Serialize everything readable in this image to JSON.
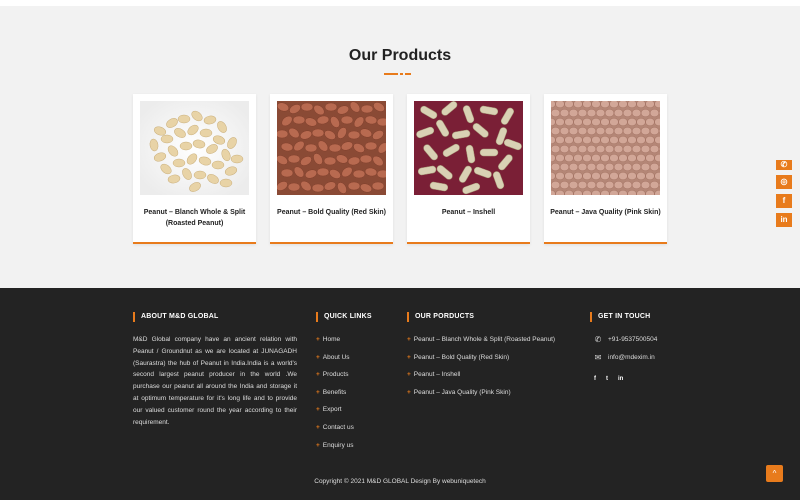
{
  "products_section": {
    "title": "Our Products",
    "items": [
      {
        "name": "Peanut – Blanch Whole & Split (Roasted Peanut)",
        "image": "blanched-peanuts-image"
      },
      {
        "name": "Peanut – Bold Quality (Red Skin)",
        "image": "red-skin-peanuts-image"
      },
      {
        "name": "Peanut – Inshell",
        "image": "inshell-peanuts-image"
      },
      {
        "name": "Peanut – Java Quality (Pink Skin)",
        "image": "pink-skin-peanuts-image"
      }
    ]
  },
  "floating_social": [
    {
      "icon": "phone-icon",
      "glyph": "✆"
    },
    {
      "icon": "whatsapp-icon",
      "glyph": "◎"
    },
    {
      "icon": "facebook-icon",
      "glyph": "f"
    },
    {
      "icon": "linkedin-icon",
      "glyph": "in"
    }
  ],
  "footer": {
    "about": {
      "title": "ABOUT M&D GLOBAL",
      "text": "M&D Global company have an ancient relation with Peanut / Groundnut as we are located at JUNAGADH (Saurastra) the hub of Peanut in India.India is a world's second largest peanut producer in the world .We purchase our peanut all around the India and storage it at optimum temperature for it's long life and to provide our valued customer round the year according to their requirement."
    },
    "quick_links": {
      "title": "QUICK LINKS",
      "items": [
        "Home",
        "About Us",
        "Products",
        "Benefits",
        "Export",
        "Contact us",
        "Enquiry us"
      ]
    },
    "our_products": {
      "title": "OUR PORDUCTS",
      "items": [
        "Peanut – Blanch Whole & Split (Roasted Peanut)",
        "Peanut – Bold Quality (Red Skin)",
        "Peanut – Inshell",
        "Peanut – Java Quality (Pink Skin)"
      ]
    },
    "get_in_touch": {
      "title": "GET IN TOUCH",
      "phone": "+91-9537500504",
      "email": "info@mdexim.in",
      "social": [
        "f",
        "t",
        "in"
      ]
    },
    "copyright": "Copyright © 2021 M&D GLOBAL  Design By webuniquetech",
    "scroll_top_glyph": "^"
  },
  "colors": {
    "accent": "#e87b1c",
    "footer_bg": "#232323",
    "section_bg": "#f2f2f2"
  }
}
